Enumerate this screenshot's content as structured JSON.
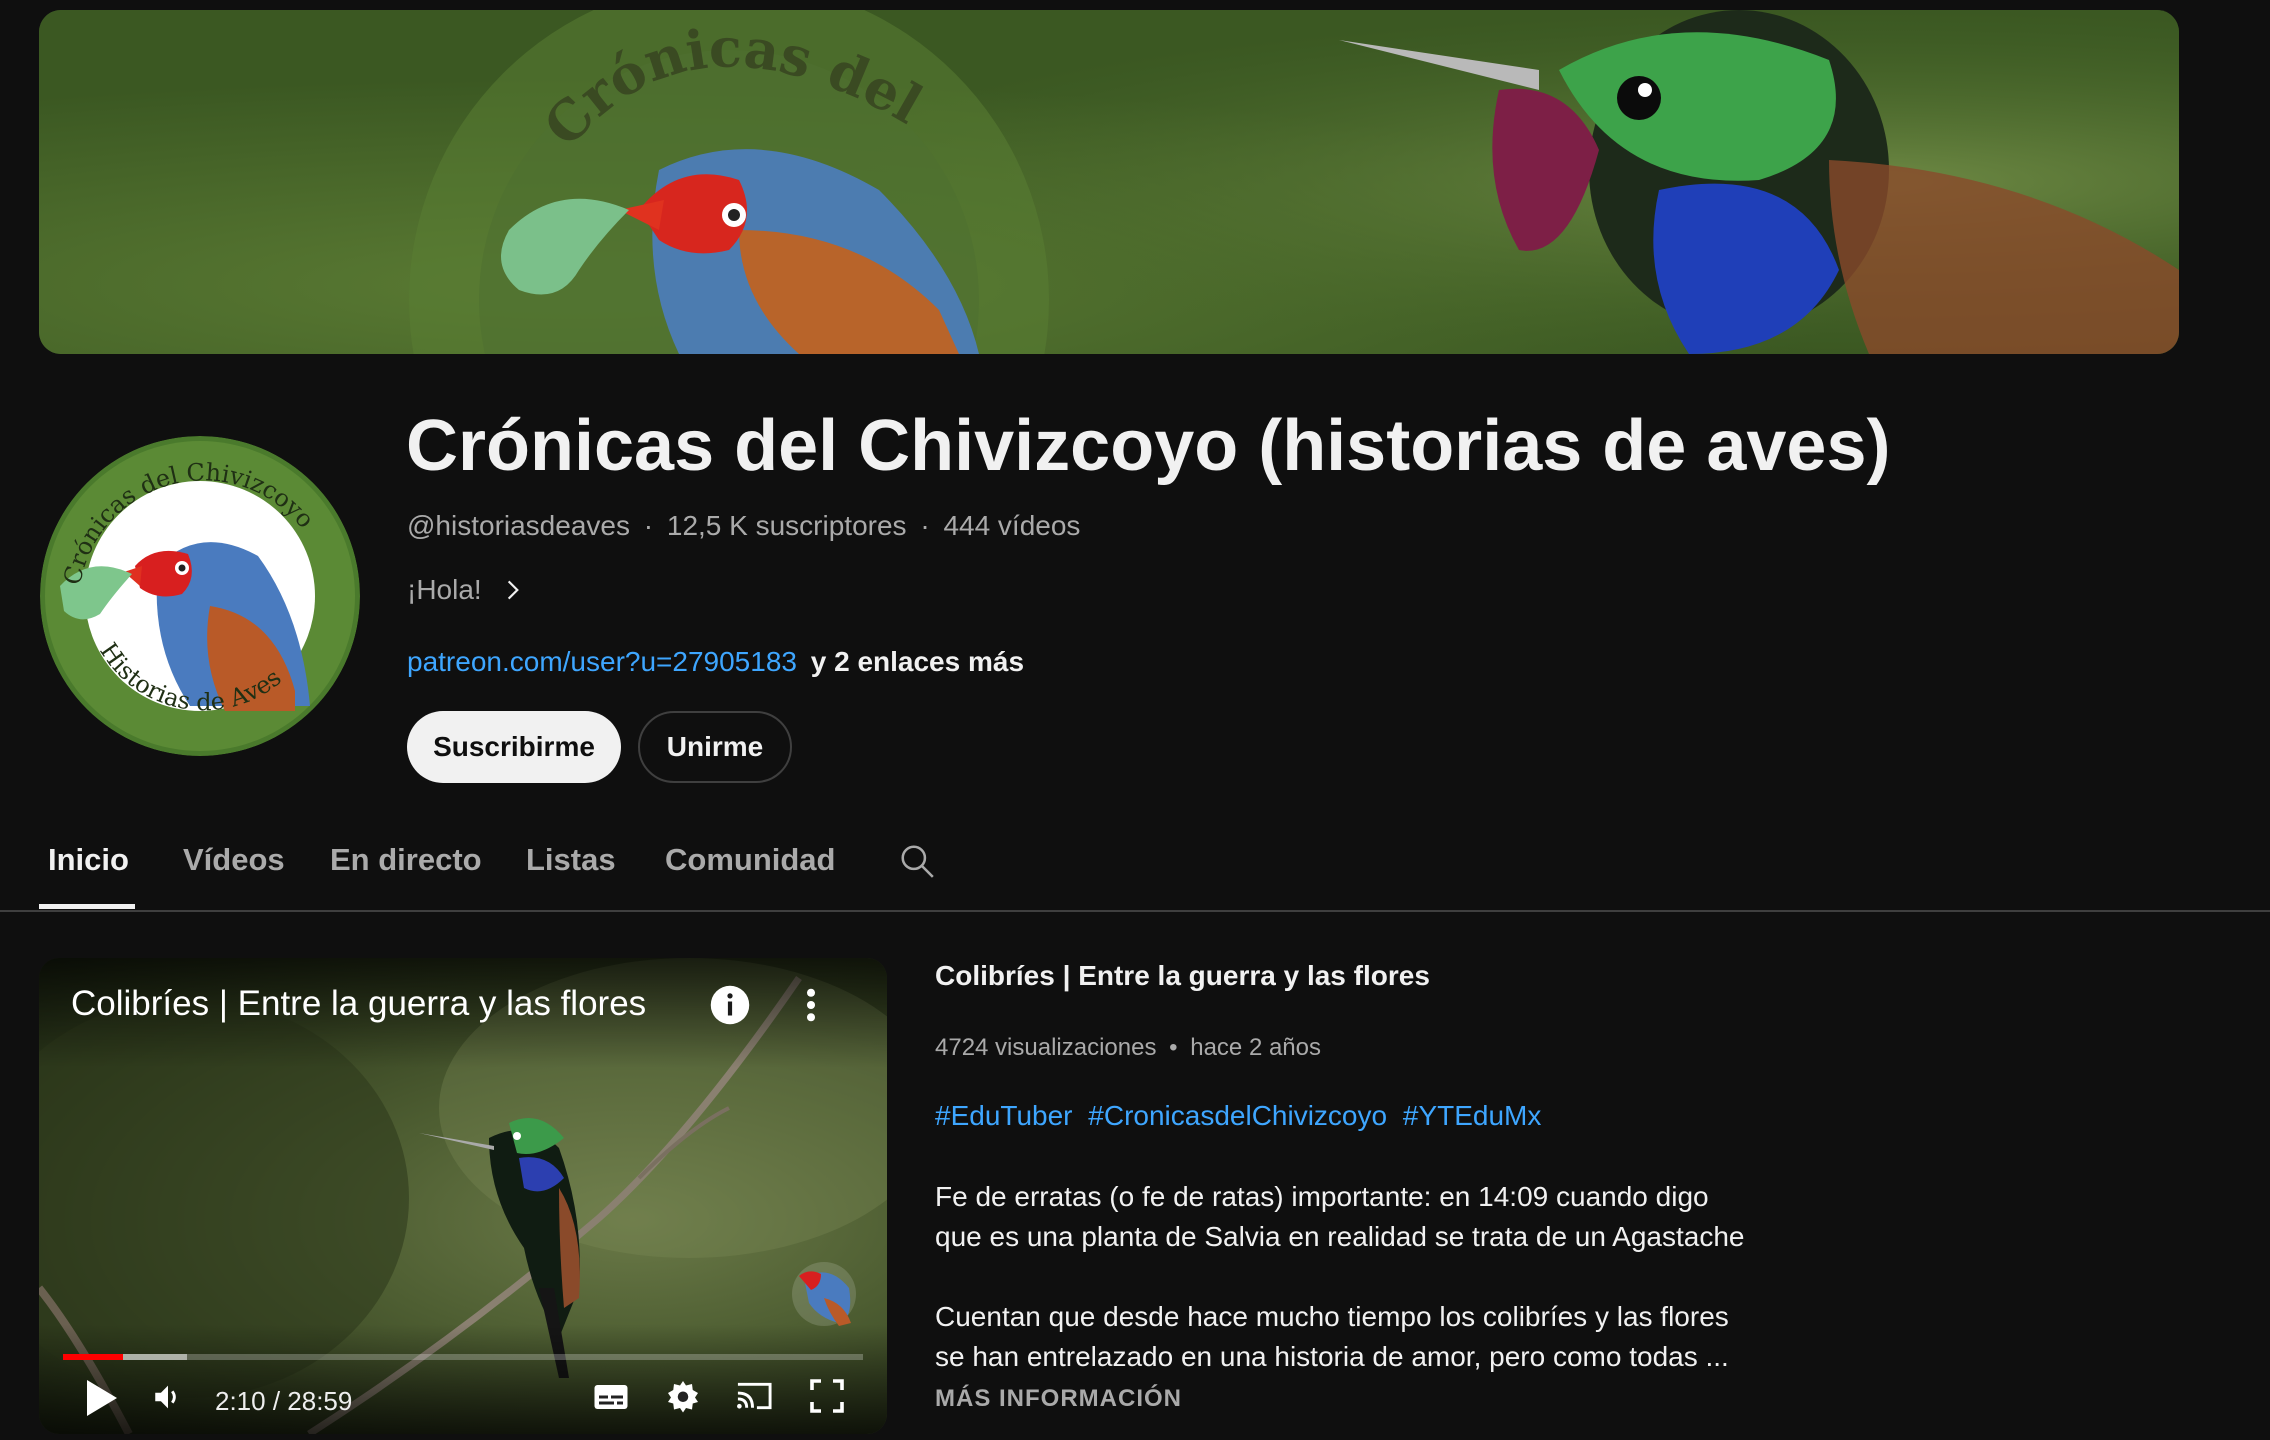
{
  "banner": {
    "text": "Crónicas del Chivizcoyo"
  },
  "avatar": {
    "top_text": "Crónicas del Chivizcoyo",
    "bottom_text": "Historias de Aves"
  },
  "channel": {
    "title": "Crónicas del Chivizcoyo (historias de aves)",
    "handle": "@historiasdeaves",
    "subscribers": "12,5 K suscriptores",
    "videos": "444 vídeos",
    "separator": "·",
    "tagline": "¡Hola!",
    "link": "patreon.com/user?u=27905183",
    "more_links": "y 2 enlaces más"
  },
  "buttons": {
    "subscribe": "Suscribirme",
    "join": "Unirme"
  },
  "tabs": [
    "Inicio",
    "Vídeos",
    "En directo",
    "Listas",
    "Comunidad"
  ],
  "player": {
    "title": "Colibríes | Entre la guerra y las flores",
    "time": "2:10 / 28:59",
    "progress_played": 0.075,
    "progress_buffered": 0.155
  },
  "video": {
    "title": "Colibríes | Entre la guerra y las flores",
    "views": "4724 visualizaciones",
    "age": "hace 2 años",
    "stats_sep": "•",
    "hashtags": [
      "#EduTuber",
      "#CronicasdelChivizcoyo",
      "#YTEduMx"
    ],
    "para1_line1": "Fe de erratas (o fe de ratas) importante: en 14:09 cuando digo",
    "para1_line2": "que es una planta de Salvia en realidad se trata de un Agastache",
    "para2_line1": "Cuentan que desde hace mucho tiempo los colibríes y las flores",
    "para2_line2": "se han entrelazado en una historia de amor, pero como todas ...",
    "more_info": "MÁS INFORMACIÓN"
  },
  "colors": {
    "background": "#0f0f0f",
    "link_blue": "#3ea6ff",
    "progress_red": "#ff0000"
  },
  "icons": [
    "chevron-right-icon",
    "search-icon",
    "info-icon",
    "more-vert-icon",
    "play-icon",
    "volume-icon",
    "subtitles-icon",
    "settings-icon",
    "cast-icon",
    "fullscreen-icon"
  ]
}
